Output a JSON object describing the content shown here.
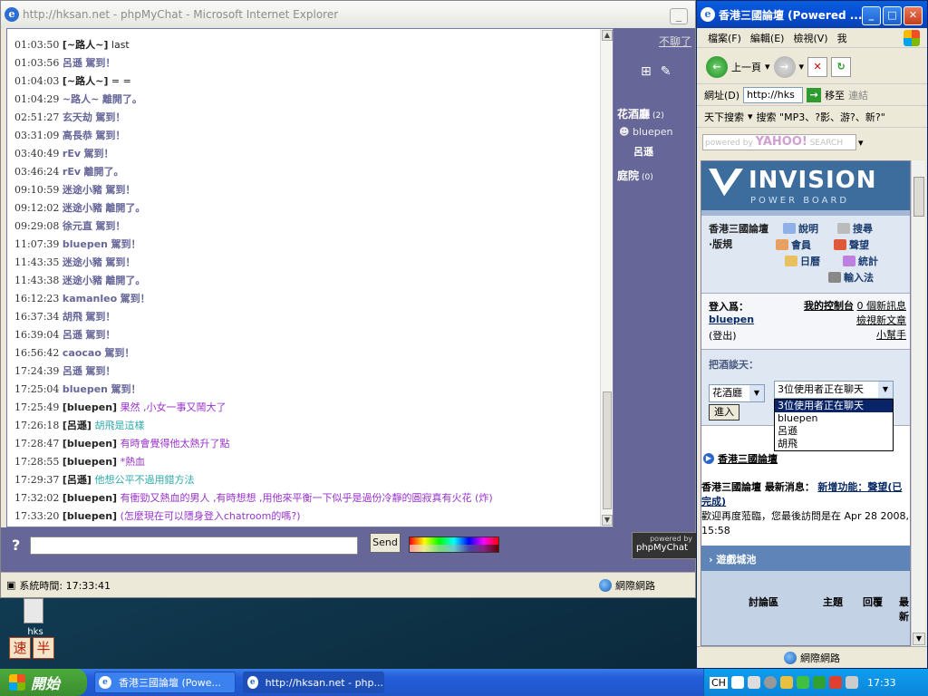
{
  "left_window": {
    "title": "http://hksan.net - phpMyChat - Microsoft Internet Explorer",
    "messages": [
      {
        "time": "01:03:50",
        "nick": "[~路人~]",
        "text": "last",
        "style": "c-plain"
      },
      {
        "time": "01:03:56",
        "nick": "呂遜",
        "text": "駕到！",
        "style": "nick"
      },
      {
        "time": "01:04:03",
        "nick": "[~路人~]",
        "text": "= =",
        "style": "c-plain"
      },
      {
        "time": "01:04:29",
        "nick": "~路人~",
        "text": "離開了。",
        "style": "nick"
      },
      {
        "time": "02:51:27",
        "nick": "玄天劫",
        "text": "駕到！",
        "style": "nick"
      },
      {
        "time": "03:31:09",
        "nick": "高長恭",
        "text": "駕到！",
        "style": "nick"
      },
      {
        "time": "03:40:49",
        "nick": "rEv",
        "text": "駕到！",
        "style": "nick"
      },
      {
        "time": "03:46:24",
        "nick": "rEv",
        "text": "離開了。",
        "style": "nick"
      },
      {
        "time": "09:10:59",
        "nick": "迷途小豬",
        "text": "駕到！",
        "style": "nick"
      },
      {
        "time": "09:12:02",
        "nick": "迷途小豬",
        "text": "離開了。",
        "style": "nick"
      },
      {
        "time": "09:29:08",
        "nick": "徐元直",
        "text": "駕到！",
        "style": "nick"
      },
      {
        "time": "11:07:39",
        "nick": "bluepen",
        "text": "駕到！",
        "style": "nick"
      },
      {
        "time": "11:43:35",
        "nick": "迷途小豬",
        "text": "駕到！",
        "style": "nick"
      },
      {
        "time": "11:43:38",
        "nick": "迷途小豬",
        "text": "離開了。",
        "style": "nick"
      },
      {
        "time": "16:12:23",
        "nick": "kamanleo",
        "text": "駕到！",
        "style": "nick"
      },
      {
        "time": "16:37:34",
        "nick": "胡飛",
        "text": "駕到！",
        "style": "nick"
      },
      {
        "time": "16:39:04",
        "nick": "呂遜",
        "text": "駕到！",
        "style": "nick"
      },
      {
        "time": "16:56:42",
        "nick": "caocao",
        "text": "駕到！",
        "style": "nick"
      },
      {
        "time": "17:24:39",
        "nick": "呂遜",
        "text": "駕到！",
        "style": "nick"
      },
      {
        "time": "17:25:04",
        "nick": "bluepen",
        "text": "駕到！",
        "style": "nick"
      },
      {
        "time": "17:25:49",
        "nick": "[bluepen]",
        "text": "果然 ,小女一事又鬧大了",
        "style": "c-purple"
      },
      {
        "time": "17:26:18",
        "nick": "[呂遜]",
        "text": "胡飛是這樣",
        "style": "c-cyan"
      },
      {
        "time": "17:28:47",
        "nick": "[bluepen]",
        "text": "有時會覺得他太熱升了點",
        "style": "c-purple"
      },
      {
        "time": "17:28:55",
        "nick": "[bluepen]",
        "text": "*熱血",
        "style": "c-purple"
      },
      {
        "time": "17:29:37",
        "nick": "[呂遜]",
        "text": "他想公平不過用錯方法",
        "style": "c-cyan"
      },
      {
        "time": "17:32:02",
        "nick": "[bluepen]",
        "text": "有衝勁又熱血的男人 ,有時想想 ,用他來平衡一下似乎是過份冷靜的圓寂真有火花 (炸)",
        "style": "c-purple"
      },
      {
        "time": "17:33:20",
        "nick": "[bluepen]",
        "text": "(怎麼現在可以隱身登入chatroom的嗎?)",
        "style": "c-purple"
      }
    ],
    "side": {
      "exit_link": "不聊了",
      "room1_name": "花酒廳",
      "room1_count": "(2)",
      "room1_user1": "bluepen",
      "room1_user2": "呂遜",
      "room2_name": "庭院",
      "room2_count": "(0)",
      "powered_small": "powered by",
      "powered": "phpMyChat"
    },
    "help_label": "?",
    "send_label": "Send",
    "status_text": "系統時間: 17:33:41",
    "status_zone": "網際網路"
  },
  "right_window": {
    "title": "香港三國論壇 (Powered ...",
    "menu": [
      "檔案(F)",
      "編輯(E)",
      "檢視(V)",
      "我"
    ],
    "back_label": "上一頁",
    "address_label": "網址(D)",
    "address_value": "http://hks",
    "go_label": "移至",
    "links_label": "連結",
    "search_label": "天下搜索",
    "search_text": "搜索 \"MP3、?影、游?、新?\"",
    "yahoo_text": "powered by",
    "yahoo_brand": "YAHOO!",
    "yahoo_search": "SEARCH",
    "banner_title": "INVISION",
    "banner_sub": "POWER BOARD",
    "forum_title": "香港三國論壇·版規",
    "links": {
      "help": "說明",
      "search": "搜尋",
      "members": "會員",
      "reputation": "聲望",
      "calendar": "日曆",
      "stats": "統計",
      "input": "輸入法"
    },
    "login_as": "登入爲：",
    "login_user": "bluepen",
    "logout": "(登出)",
    "control_panel": "我的控制台",
    "new_msgs": "0 個新訊息",
    "view_new": "檢視新文章",
    "helper": "小幫手",
    "chat_label": "把酒談天：",
    "room_select": "花酒廳",
    "users_select": "3位使用者正在聊天",
    "enter_label": "進入",
    "dropdown_options": [
      "3位使用者正在聊天",
      "bluepen",
      "呂遜",
      "胡飛"
    ],
    "news_header": "香港三國論壇",
    "news_title": "香港三國論壇 最新消息：",
    "news_link": "新增功能：聲望(已完成)",
    "welcome": "歡迎再度蒞臨，您最後訪問是在 Apr 28 2008, 15:58",
    "table_title": "遊戲城池",
    "table_cols": [
      "討論區",
      "主題",
      "回覆",
      "最新"
    ],
    "status_zone": "網際網路"
  },
  "taskbar": {
    "start_label": "開始",
    "task1": "香港三國論壇 (Powe...",
    "task2": "http://hksan.net - php...",
    "lang": "CH",
    "clock": "17:33"
  },
  "desktop": {
    "icon_label": "hks",
    "ime_keys": [
      "速",
      "半"
    ]
  }
}
